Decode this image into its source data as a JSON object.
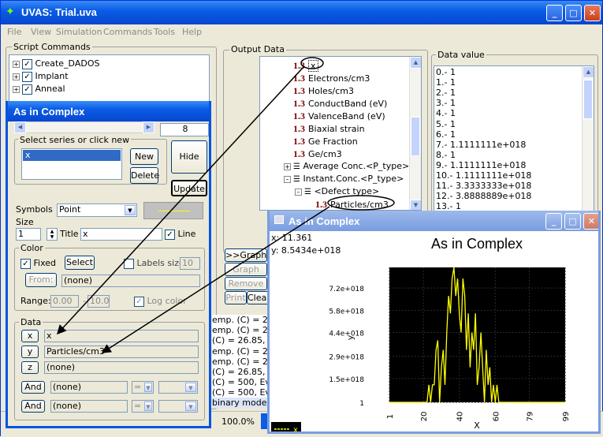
{
  "app": {
    "title": "UVAS: Trial.uva",
    "menu": [
      "File",
      "View",
      "Simulation",
      "Commands",
      "Tools",
      "Help"
    ]
  },
  "script_commands": {
    "label": "Script Commands",
    "items": [
      "Create_DADOS",
      "Implant",
      "Anneal"
    ]
  },
  "output_data": {
    "label": "Output Data",
    "tree": [
      "x",
      "Electrons/cm3",
      "Holes/cm3",
      "ConductBand (eV)",
      "ValenceBand (eV)",
      "Biaxial strain",
      "Ge Fraction",
      "Ge/cm3"
    ],
    "icon_label": "1.3",
    "average": "Average Conc.<P_type>",
    "instant": "Instant.Conc.<P_type>",
    "defect": "<Defect type>",
    "particles": "Particles/cm3",
    "buttons": [
      ">>Graph",
      "Graph",
      "Remove",
      "Print",
      "Clear"
    ]
  },
  "data_value": {
    "label": "Data value",
    "rows": [
      "0.- 1",
      "1.- 1",
      "2.- 1",
      "3.- 1",
      "4.- 1",
      "5.- 1",
      "6.- 1",
      "7.- 1.1111111e+018",
      "8.- 1",
      "9.- 1.1111111e+018",
      "10.- 1.1111111e+018",
      "11.- 3.3333333e+018",
      "12.- 3.8888889e+018",
      "13.- 1"
    ]
  },
  "log": {
    "lines": [
      "emp. (C) = 26.8",
      "emp. (C) = 26.8",
      "(C) = 26.85, Ev",
      "emp. (C) = 26.8",
      "emp. (C) = 26.8",
      "(C) = 26.85, Eve",
      "(C) = 500, Eve",
      "(C) = 500, Eve",
      "binary mode ve"
    ]
  },
  "status": {
    "zoom": "100.0%"
  },
  "complex_dialog": {
    "title": "As in Complex",
    "counter": "8",
    "series_label": "Select series or click new",
    "series_items": [
      "x"
    ],
    "new": "New",
    "delete": "Delete",
    "hide": "Hide",
    "update": "Update",
    "symbols_label": "Symbols",
    "symbols_value": "Point",
    "size_label": "Size",
    "size_value": "1",
    "title_label": "Title",
    "title_value": "x",
    "line_label": "Line",
    "color_label": "Color",
    "fixed_label": "Fixed",
    "select_label": "Select",
    "labels_size_label": "Labels size",
    "labels_size_value": "10",
    "from_label": "From:",
    "from_value": "(none)",
    "range_label": "Range:",
    "range_min": "0.00",
    "range_max": "10.0",
    "range_dash": "-",
    "log_color": "Log color",
    "data_label": "Data",
    "x_btn": "x",
    "x_value": "x",
    "y_btn": "y",
    "y_value": "Particles/cm3",
    "z_btn": "z",
    "z_value": "(none)",
    "and1": "And",
    "and1_value": "(none)",
    "and1_op": "=",
    "and2": "And",
    "and2_value": "(none)",
    "and2_op": "="
  },
  "chart_window": {
    "title": "As in Complex",
    "readout_x": "x: 11.361",
    "readout_y": "y: 8.5434e+018",
    "legend": "x",
    "colors": {
      "plot_bg": "#000000",
      "line": "#ffff00"
    }
  },
  "chart_data": {
    "type": "line",
    "title": "As in Complex",
    "xlabel": "X",
    "ylabel": "y",
    "xlim": [
      1,
      99
    ],
    "ylim": [
      1,
      8.5e+18
    ],
    "x_ticks": [
      "1",
      "20",
      "40",
      "60",
      "79",
      "99"
    ],
    "y_ticks": [
      "1",
      "1.5e+018",
      "2.9e+018",
      "4.4e+018",
      "5.8e+018",
      "7.2e+018"
    ],
    "x_tick_values": [
      1,
      20,
      40,
      60,
      79,
      99
    ],
    "y_tick_values": [
      1,
      1.5e+18,
      2.9e+18,
      4.4e+18,
      5.8e+18,
      7.2e+18
    ],
    "series": [
      {
        "name": "x",
        "x": [
          1,
          2,
          3,
          4,
          5,
          6,
          7,
          8,
          9,
          10,
          11,
          12,
          13,
          14,
          15,
          16,
          17,
          18,
          19,
          20,
          21,
          22,
          23,
          24,
          25,
          26,
          27,
          28,
          29,
          30,
          31,
          32,
          33,
          34,
          35,
          36,
          37,
          38,
          39,
          40,
          41,
          42,
          43,
          44,
          45,
          46,
          47,
          48,
          49,
          50,
          51,
          52,
          53,
          54,
          55,
          56,
          57,
          58,
          59,
          60,
          61,
          62,
          63,
          64,
          65,
          66,
          67,
          68,
          69,
          70,
          71,
          72,
          73,
          74,
          75,
          76,
          77,
          78,
          79,
          80,
          81,
          82,
          83,
          84,
          85,
          86,
          87,
          88,
          89,
          90,
          91,
          92,
          93,
          94,
          95,
          96,
          97,
          98,
          99
        ],
        "y": [
          1,
          1,
          1,
          1,
          1,
          1,
          1,
          1,
          1,
          1,
          1,
          1,
          1,
          1,
          1,
          1,
          1,
          1,
          1,
          1,
          1,
          1,
          1.1e+18,
          1,
          1.1e+18,
          1.1e+18,
          3.3e+18,
          3.9e+18,
          1,
          2.2e+18,
          3.3e+18,
          1.1e+18,
          4.4e+18,
          6.7e+18,
          5.6e+18,
          7.8e+18,
          8.5e+18,
          6.7e+18,
          7.8e+18,
          5.6e+18,
          4.4e+18,
          7.8e+18,
          6.7e+18,
          3.3e+18,
          5.6e+18,
          2.2e+18,
          4.4e+18,
          3.3e+18,
          5.6e+18,
          1.1e+18,
          2.2e+18,
          4.4e+18,
          2.2e+18,
          1,
          3.3e+18,
          1.1e+18,
          2.2e+18,
          1,
          1.1e+18,
          1,
          1.1e+18,
          1,
          1,
          1,
          1,
          1,
          1,
          1,
          1,
          1,
          1,
          1,
          1,
          1,
          1,
          1,
          1,
          1,
          1,
          1,
          1,
          1,
          1,
          1,
          1,
          1,
          1,
          1,
          1,
          1,
          1,
          1,
          1,
          1,
          1,
          1,
          1,
          1,
          1
        ]
      }
    ]
  }
}
